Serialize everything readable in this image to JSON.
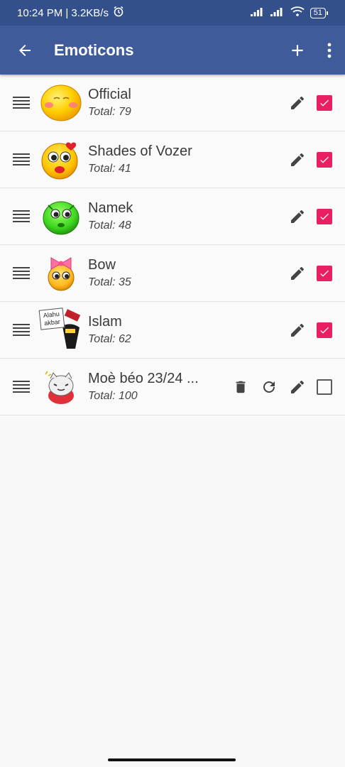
{
  "status_bar": {
    "time_speed": "10:24 PM | 3.2KB/s",
    "battery": "51"
  },
  "app_bar": {
    "title": "Emoticons",
    "back_icon": "arrow-left-icon",
    "add_icon": "plus-icon",
    "menu_icon": "more-vert-icon"
  },
  "colors": {
    "app_bar": "#3f5b9a",
    "status_bar": "#33508c",
    "checkbox_checked": "#e91e63"
  },
  "packs": [
    {
      "name": "Official",
      "total": "Total: 79",
      "checked": true
    },
    {
      "name": "Shades of Vozer",
      "total": "Total: 41",
      "checked": true
    },
    {
      "name": "Namek",
      "total": "Total: 48",
      "checked": true
    },
    {
      "name": "Bow",
      "total": "Total: 35",
      "checked": true
    },
    {
      "name": "Islam",
      "total": "Total: 62",
      "checked": true,
      "sign_text_1": "Alahu",
      "sign_text_2": "akbar"
    },
    {
      "name": "Moè béo 23/24 ...",
      "total": "Total: 100",
      "checked": false
    }
  ]
}
